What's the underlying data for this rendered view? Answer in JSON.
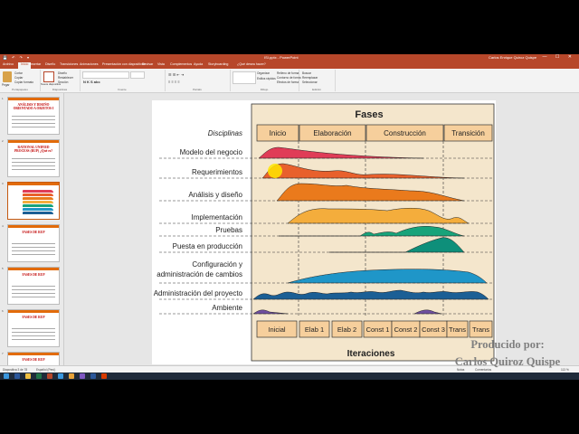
{
  "window": {
    "title": "ISI.pptx - PowerPoint",
    "user": "Carlos Enrique Quiroz Quispe",
    "window_controls": "— ☐ ✕"
  },
  "quick_access": "💾 ↶ ↷ ▾",
  "tabs": [
    "Archivo",
    "Inicio",
    "Insertar",
    "Diseño",
    "Transiciones",
    "Animaciones",
    "Presentación con diapositivas",
    "Revisar",
    "Vista",
    "Complementos",
    "Ayuda",
    "Storyboarding",
    "¿Qué desea hacer?"
  ],
  "ribbon": {
    "clipboard": {
      "paste": "Pegar",
      "cut": "Cortar",
      "copy": "Copiar",
      "format_painter": "Copiar formato",
      "group": "Portapapeles"
    },
    "slides": {
      "new": "Nueva diapositiva",
      "layout": "Diseño",
      "reset": "Restablecer",
      "section": "Sección",
      "group": "Diapositivas"
    },
    "font_group": "Fuente",
    "paragraph_group": "Párrafo",
    "drawing": {
      "arrange": "Organizar",
      "styles": "Estilos rápidos",
      "fill": "Relleno de forma",
      "outline": "Contorno de forma",
      "effects": "Efectos de forma",
      "group": "Dibujo"
    },
    "editing": {
      "find": "Buscar",
      "replace": "Reemplazar",
      "select": "Seleccionar",
      "group": "Edición"
    }
  },
  "thumbnails": [
    {
      "num": "1",
      "title": "ANÁLISIS Y DISEÑO ORIENTADO A OBJETOS I"
    },
    {
      "num": "2",
      "title": "RATIONAL UNIFIED PROCESS (RUP) ¿Qué es?"
    },
    {
      "num": "3",
      "title": ""
    },
    {
      "num": "4",
      "title": "FASES DE RUP"
    },
    {
      "num": "5",
      "title": "FASES DE RUP"
    },
    {
      "num": "6",
      "title": "FASES DE RUP"
    },
    {
      "num": "7",
      "title": "FASES DE RUP"
    }
  ],
  "diagram": {
    "fases_title": "Fases",
    "disciplinas_label": "Disciplinas",
    "phases": [
      "Inicio",
      "Elaboración",
      "Construcción",
      "Transición"
    ],
    "disciplines": [
      "Modelo del negocio",
      "Requerimientos",
      "Análisis y diseño",
      "Implementación",
      "Pruebas",
      "Puesta en producción",
      "Configuración y",
      "administración de cambios",
      "Administración del proyecto",
      "Ambiente"
    ],
    "iterations": [
      "Inicial",
      "Elab 1",
      "Elab 2",
      "Const 1",
      "Const 2",
      "Const 3",
      "Trans",
      "Trans"
    ],
    "iteraciones_title": "Iteraciones",
    "colors": {
      "panel": "#f4e6cc",
      "box": "#f6cf9c",
      "business": "#e03c57",
      "requirements": "#e8602c",
      "analysis": "#ea7a1c",
      "impl": "#f4ad3c",
      "tests": "#18a37a",
      "deploy": "#0e8f7a",
      "config": "#1f96c8",
      "pm": "#1b5f95",
      "env": "#6f4fa0"
    }
  },
  "credit": {
    "line1": "Producido por:",
    "line2": "Carlos Quiroz Quispe"
  },
  "status": {
    "slide": "Diapositiva 3 de 78",
    "lang": "Español (Perú)",
    "notes": "Notas",
    "comments": "Comentarios",
    "zoom": "113 %"
  }
}
